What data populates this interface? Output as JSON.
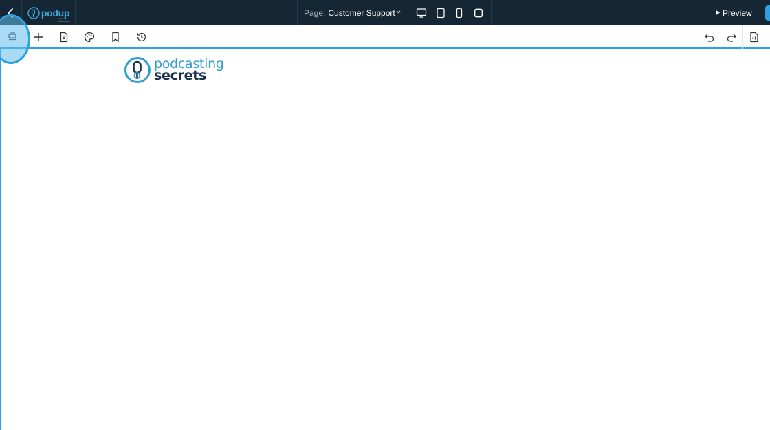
{
  "app": {
    "logo_text": "podup",
    "logo_subtitle": "by Easy Broadcasters"
  },
  "header": {
    "page_label": "Page:",
    "page_value": "Customer Support",
    "preview_label": "Preview",
    "devices": [
      "desktop-icon",
      "tablet-icon",
      "mobile-icon",
      "square-icon"
    ]
  },
  "toolbar": {
    "left_tools": [
      "layers-icon",
      "plus-icon",
      "page-icon",
      "palette-icon",
      "bookmark-icon",
      "history-icon"
    ],
    "right_tools": [
      "undo-icon",
      "redo-icon",
      "code-file-icon"
    ]
  },
  "canvas": {
    "brand_line1": "podcasting",
    "brand_line2": "secrets"
  },
  "colors": {
    "topbar": "#152634",
    "accent": "#2e9fe0",
    "brand_blue": "#2f9fd0",
    "brand_dark": "#17324a"
  }
}
